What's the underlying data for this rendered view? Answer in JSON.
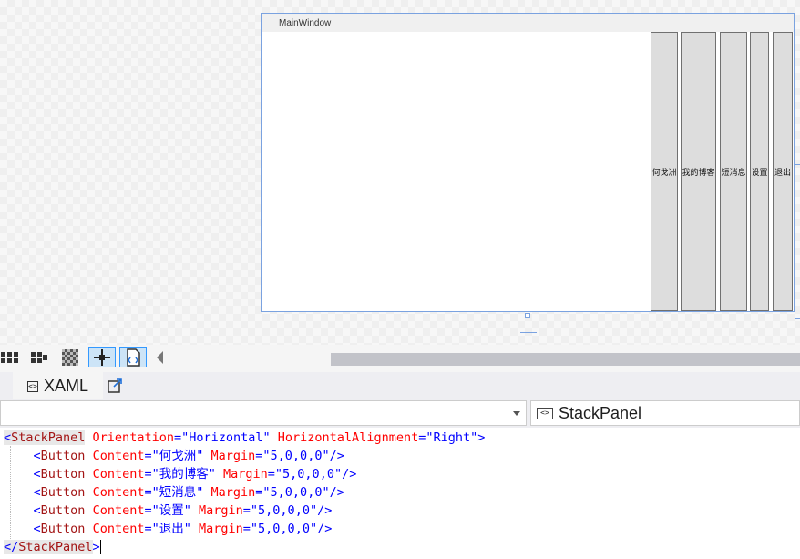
{
  "designer": {
    "window_title": "MainWindow",
    "buttons": [
      "何戈洲",
      "我的博客",
      "短消息",
      "设置",
      "退出"
    ]
  },
  "toolbar": {
    "icons": [
      "grid-icon",
      "snap-grid-icon",
      "transparency-icon",
      "snap-lines-icon",
      "project-code-icon"
    ]
  },
  "tabs": {
    "xaml_label": "XAML",
    "xaml_icon": "<>"
  },
  "nav": {
    "left_value": "",
    "right_value": "StackPanel",
    "right_icon": "<>"
  },
  "code": {
    "l1": {
      "open": "<",
      "tag": "StackPanel",
      "a1": " Orientation",
      "eq1": "=",
      "v1": "\"Horizontal\"",
      "a2": " HorizontalAlignment",
      "eq2": "=",
      "v2": "\"Right\"",
      "close": ">"
    },
    "lines": [
      {
        "indent": "    ",
        "open": "<",
        "tag": "Button",
        "a1": " Content",
        "eq1": "=",
        "v1": "\"何戈洲\"",
        "a2": " Margin",
        "eq2": "=",
        "v2": "\"5,0,0,0\"",
        "close": "/>"
      },
      {
        "indent": "    ",
        "open": "<",
        "tag": "Button",
        "a1": " Content",
        "eq1": "=",
        "v1": "\"我的博客\"",
        "a2": " Margin",
        "eq2": "=",
        "v2": "\"5,0,0,0\"",
        "close": "/>"
      },
      {
        "indent": "    ",
        "open": "<",
        "tag": "Button",
        "a1": " Content",
        "eq1": "=",
        "v1": "\"短消息\"",
        "a2": " Margin",
        "eq2": "=",
        "v2": "\"5,0,0,0\"",
        "close": "/>"
      },
      {
        "indent": "    ",
        "open": "<",
        "tag": "Button",
        "a1": " Content",
        "eq1": "=",
        "v1": "\"设置\"",
        "a2": " Margin",
        "eq2": "=",
        "v2": "\"5,0,0,0\"",
        "close": "/>"
      },
      {
        "indent": "    ",
        "open": "<",
        "tag": "Button",
        "a1": " Content",
        "eq1": "=",
        "v1": "\"退出\"",
        "a2": " Margin",
        "eq2": "=",
        "v2": "\"5,0,0,0\"",
        "close": "/>"
      }
    ],
    "last": {
      "open": "</",
      "tag": "StackPanel",
      "close": ">"
    }
  },
  "colors": {
    "selection": "#7aa2e0",
    "button_face": "#dddddd",
    "tag": "#a31515",
    "attribute": "#ff0000",
    "value": "#0000ff"
  }
}
